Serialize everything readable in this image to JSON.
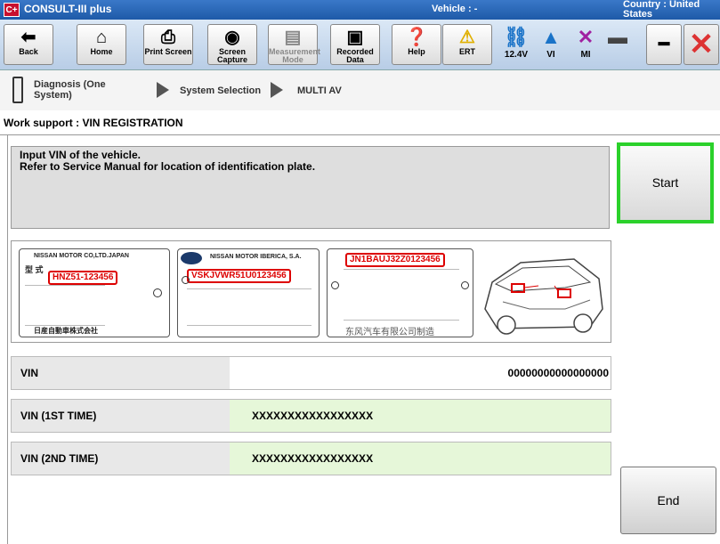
{
  "titlebar": {
    "logo": "C+",
    "app_title": "CONSULT-III plus",
    "vehicle": "Vehicle : -",
    "country": "Country : United States"
  },
  "toolbar": {
    "back": "Back",
    "home": "Home",
    "print_screen": "Print Screen",
    "screen_capture": "Screen Capture",
    "measurement_mode": "Measurement Mode",
    "recorded_data": "Recorded Data",
    "help": "Help",
    "ert": "ERT",
    "battery": "12.4V",
    "vi": "VI",
    "mi": "MI"
  },
  "breadcrumb": {
    "diagnosis": "Diagnosis (One System)",
    "system_selection": "System Selection",
    "current": "MULTI AV"
  },
  "section_title": "Work support : VIN REGISTRATION",
  "instructions": {
    "line1": "Input VIN of the vehicle.",
    "line2": "Refer to Service Manual for location of identification plate."
  },
  "start_label": "Start",
  "plates": {
    "plate1_header": "NISSAN MOTOR CO,LTD.JAPAN",
    "plate1_vin": "HNZ51-123456",
    "plate1_footer": "日産自動車株式会社",
    "plate2_header": "NISSAN MOTOR IBERICA, S.A.",
    "plate2_vin": "VSKJVWR51U0123456",
    "plate3_vin": "JN1BAUJ32Z0123456",
    "plate3_footer": "东风汽车有限公司制造"
  },
  "fields": {
    "vin_label": "VIN",
    "vin_value": "00000000000000000",
    "vin1_label": "VIN (1ST TIME)",
    "vin1_value": "XXXXXXXXXXXXXXXXX",
    "vin2_label": "VIN (2ND TIME)",
    "vin2_value": "XXXXXXXXXXXXXXXXX"
  },
  "end_label": "End",
  "colors": {
    "highlight_green": "#2bd12b",
    "input_green": "#e6f7d9",
    "title_blue": "#1e5aa8"
  }
}
